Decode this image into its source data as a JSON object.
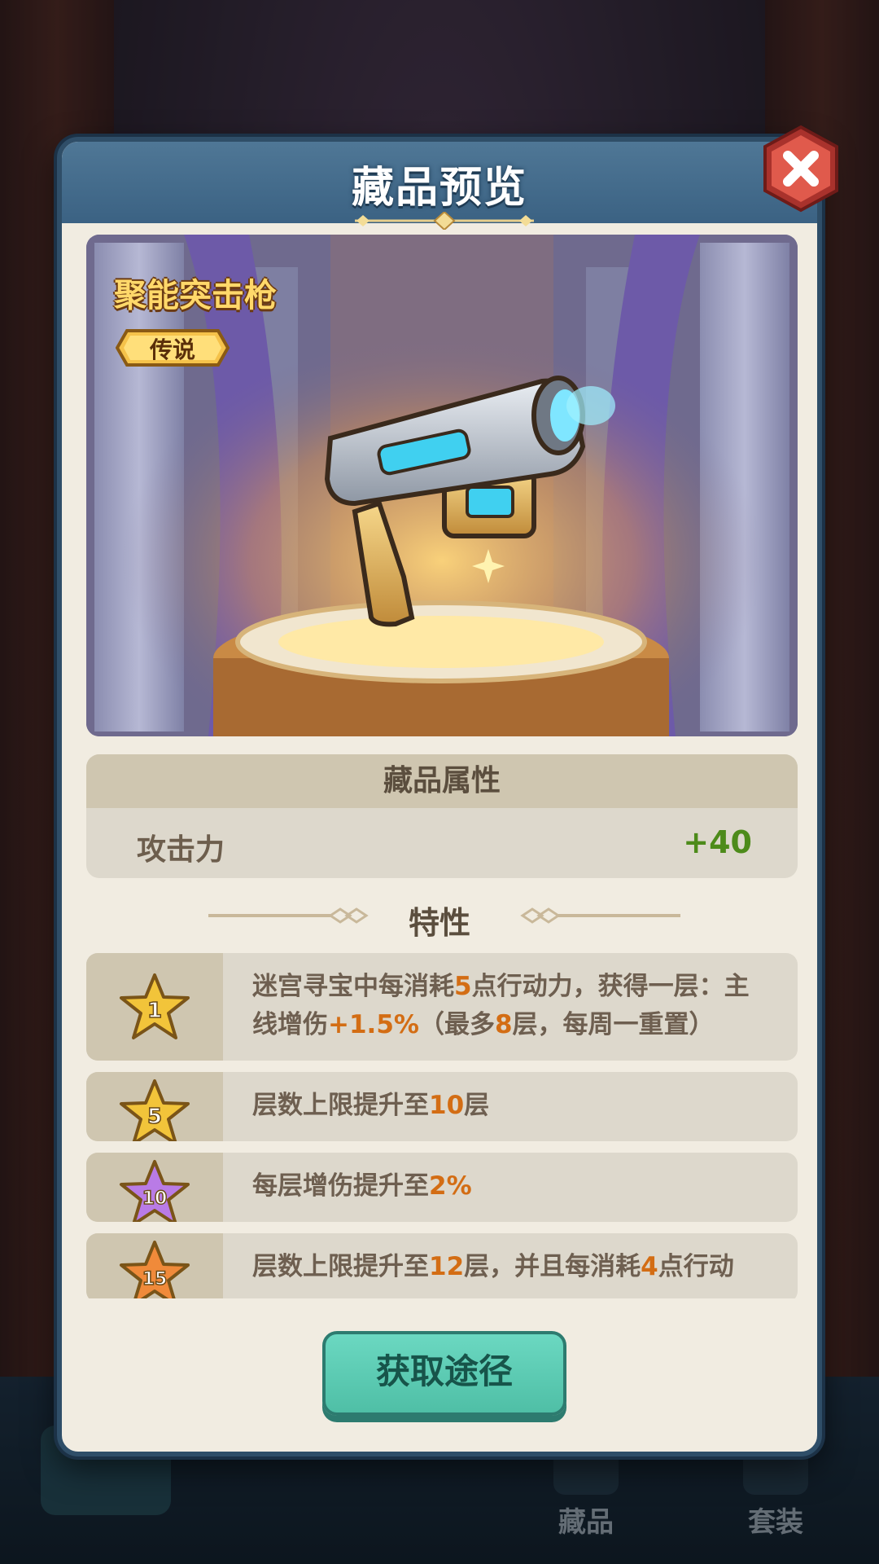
{
  "modal": {
    "title": "藏品预览",
    "close_icon": "close-icon"
  },
  "item": {
    "name": "聚能突击枪",
    "rarity": "传说",
    "image": "energy-assault-gun-icon"
  },
  "attributes": {
    "header": "藏品属性",
    "rows": [
      {
        "name": "攻击力",
        "value": "+40"
      }
    ]
  },
  "traits": {
    "title": "特性",
    "items": [
      {
        "level": "1",
        "star_color": "#f2c43a",
        "segments": [
          {
            "t": "迷宫寻宝中每消耗"
          },
          {
            "t": "5",
            "h": true
          },
          {
            "t": "点行动力，获得一层："
          },
          {
            "t": "主线增伤"
          },
          {
            "t": "+1.5%",
            "h": true
          },
          {
            "t": "（最多"
          },
          {
            "t": "8",
            "h": true
          },
          {
            "t": "层，每周一重置）"
          }
        ]
      },
      {
        "level": "5",
        "star_color": "#f2c43a",
        "segments": [
          {
            "t": "层数上限提升至"
          },
          {
            "t": "10",
            "h": true
          },
          {
            "t": "层"
          }
        ]
      },
      {
        "level": "10",
        "star_color": "#b97be6",
        "segments": [
          {
            "t": "每层增伤提升至"
          },
          {
            "t": "2%",
            "h": true
          }
        ]
      },
      {
        "level": "15",
        "star_color": "#f08a3a",
        "segments": [
          {
            "t": "层数上限提升至"
          },
          {
            "t": "12",
            "h": true
          },
          {
            "t": "层，并且每消耗"
          },
          {
            "t": "4",
            "h": true
          },
          {
            "t": "点行动"
          }
        ]
      }
    ]
  },
  "actions": {
    "obtain_label": "获取途径"
  },
  "bottom_nav": {
    "collection_label": "藏品",
    "set_label": "套装"
  },
  "colors": {
    "highlight": "#d36d14",
    "positive": "#4d8b1a",
    "header_blue": "#3b6283"
  }
}
